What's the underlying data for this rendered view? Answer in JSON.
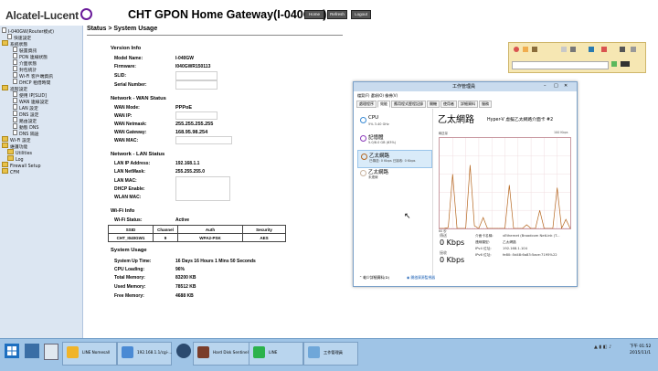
{
  "router": {
    "brand": "Alcatel-Lucent",
    "title": "CHT GPON Home Gateway(I-040GW)",
    "buttons": {
      "home": "Home",
      "refresh": "Refresh",
      "logout": "Logout"
    },
    "breadcrumb": "Status > System Usage",
    "tree": [
      "I-040GW(Router模式)",
      "快速設定",
      "系統狀態",
      "裝置資訊",
      "PON 連線狀態",
      "介面狀態",
      "封包統計",
      "Wi-Fi 客戶端資訊",
      "DHCP 租借時間",
      "進階設定",
      "使用 IP[SLID]",
      "WAN 連線設定",
      "LAN 設定",
      "DNS 設定",
      "路由設定",
      "動態 DNS",
      "DNS 隔途",
      "Wi-Fi 設定",
      "維護功能",
      "Utilities",
      "Log",
      "Firewall Setup",
      "CFM"
    ],
    "version": {
      "section": "Version Info",
      "model_label": "Model Name:",
      "model": "I-040GW",
      "firmware_label": "Firmware:",
      "firmware": "I040GWR150113",
      "slid_label": "SLID:",
      "serial_label": "Serial Number:"
    },
    "wan": {
      "section": "Network - WAN Status",
      "mode_label": "WAN Mode:",
      "mode": "PPPoE",
      "ip_label": "WAN IP:",
      "netmask_label": "WAN Netmask:",
      "netmask": "255.255.255.255",
      "gateway_label": "WAN Gateway:",
      "gateway": "168.95.98.254",
      "mac_label": "WAN MAC:"
    },
    "lan": {
      "section": "Network - LAN Status",
      "ip_label": "LAN IP Address:",
      "ip": "192.168.1.1",
      "netmask_label": "LAN NetMask:",
      "netmask": "255.255.255.0",
      "mac_label": "LAN MAC:",
      "dhcp_label": "DHCP Enable:",
      "wlan_label": "WLAN MAC:"
    },
    "wifi": {
      "section": "Wi-Fi Info",
      "status_label": "Wi-Fi Status:",
      "status": "Active",
      "headers": [
        "SSID",
        "Channel",
        "Auth",
        "Security"
      ],
      "row": [
        "CHT_I040GW1",
        "9",
        "WPA2-PSK",
        "AES"
      ]
    },
    "usage": {
      "section": "System Usage",
      "uptime_label": "System Up Time:",
      "uptime": "16 Days 16 Hours 1 Mins 50 Seconds",
      "cpu_label": "CPU Loading:",
      "cpu": "96%",
      "total_label": "Total Memory:",
      "total": "83200 KB",
      "used_label": "Used Memory:",
      "used": "78512 KB",
      "free_label": "Free Memory:",
      "free": "4688 KB"
    }
  },
  "taskmgr": {
    "title": "工作管理員",
    "menu": "檔案(F)  選項(O)  檢視(V)",
    "tabs": [
      "處理程序",
      "效能",
      "應用程式歷程記錄",
      "開機",
      "使用者",
      "詳細資料",
      "服務"
    ],
    "items": [
      {
        "name": "CPU",
        "detail": "5%  3.40 GHz"
      },
      {
        "name": "記憶體",
        "detail": "5.0/8.0 GB (63%)"
      },
      {
        "name": "乙太網路",
        "detail": "已傳送: 0 Kbps 已接收: 0 Kbps"
      },
      {
        "name": "乙太網路",
        "detail": "未連線"
      }
    ],
    "heading": "乙太網路",
    "adapter": "Hyper-V 虛擬乙太網路介面卡 #2",
    "graph_label": "輸送量",
    "graph_max": "100 Kbps",
    "graph_time": "60 秒",
    "send_label": "傳送",
    "send_val": "0 Kbps",
    "recv_label": "接收",
    "recv_val": "0 Kbps",
    "info": [
      [
        "介面卡名稱:",
        "vEthernet (Broadcom NetLink (T..."
      ],
      [
        "連線類型:",
        "乙太網路"
      ],
      [
        "IPv4 位址:",
        "192.168.1.104"
      ],
      [
        "IPv6 位址:",
        "fe80::5d48:6a83:5ace:7195%22"
      ]
    ],
    "less": "較少詳細資料(D)",
    "monitor": "開啟資源監視器"
  },
  "taskbar": {
    "apps": [
      {
        "label": "LINE Nomesall",
        "color": "#f0b429"
      },
      {
        "label": "192.168.1.1/cgi-...",
        "color": "#4a8ad4"
      },
      {
        "label": "Hard Disk Sentinel",
        "color": "#7a3d2a"
      },
      {
        "label": "LINE",
        "color": "#2bb24c"
      },
      {
        "label": "工作管理員",
        "color": "#6fa7d9"
      }
    ],
    "time": "下午 01:52",
    "date": "2015/11/1"
  },
  "chart_data": {
    "type": "line",
    "title": "輸送量",
    "ylim": [
      0,
      100
    ],
    "ylabel_max": "100 Kbps",
    "x": [
      0,
      2,
      4,
      6,
      8,
      10,
      12,
      14,
      16,
      18,
      20,
      22,
      24,
      26,
      28,
      30,
      32,
      34,
      36,
      38,
      40,
      42,
      44,
      46,
      48,
      50,
      52,
      54,
      56,
      58,
      60
    ],
    "series": [
      {
        "values": [
          0,
          0,
          0,
          0,
          0,
          0,
          0,
          0,
          0,
          0,
          0,
          0,
          0,
          0,
          0,
          0,
          0,
          0,
          0,
          0,
          0,
          0,
          0,
          0,
          0,
          0,
          0,
          0,
          0,
          0,
          0
        ]
      },
      {
        "values": [
          0,
          0,
          1,
          60,
          0,
          0,
          0,
          70,
          3,
          0,
          12,
          0,
          0,
          0,
          0,
          0,
          48,
          0,
          0,
          0,
          4,
          0,
          0,
          20,
          0,
          0,
          0,
          45,
          0,
          10,
          0
        ]
      }
    ]
  }
}
